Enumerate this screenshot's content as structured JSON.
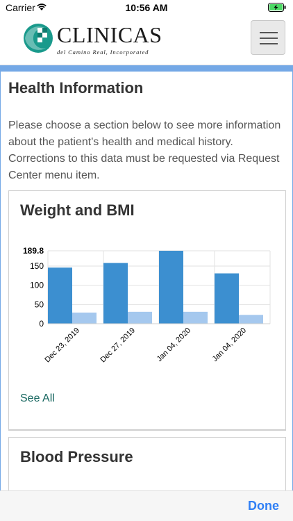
{
  "status_bar": {
    "carrier": "Carrier",
    "time": "10:56 AM"
  },
  "header": {
    "logo_text": "CLINICAS",
    "logo_subtitle": "del Camino Real, Incorporated",
    "brand_color": "#1a9a8c"
  },
  "page": {
    "title": "Health Information",
    "intro": "Please choose a section below to see more information about the patient's health and medical history. Corrections to this data must be requested via Request Center menu item."
  },
  "weight_panel": {
    "title": "Weight and BMI",
    "see_all": "See All"
  },
  "bp_panel": {
    "title": "Blood Pressure"
  },
  "bottom_bar": {
    "done_label": "Done"
  },
  "colors": {
    "accent_stripe": "#74a8e6",
    "link": "#14655e",
    "done": "#2f7ff5"
  },
  "chart_data": {
    "type": "bar",
    "categories": [
      "Dec 23, 2019",
      "Dec 27, 2019",
      "Jan 04, 2020",
      "Jan 04, 2020"
    ],
    "series": [
      {
        "values": [
          146,
          158,
          189.8,
          131
        ],
        "color": "#3c8fd0"
      },
      {
        "values": [
          29,
          31,
          31,
          23
        ],
        "color": "#a5c8ee"
      }
    ],
    "yticks": [
      0,
      50,
      100,
      150,
      189.8
    ],
    "ylim": [
      0,
      189.8
    ],
    "grid": true
  }
}
